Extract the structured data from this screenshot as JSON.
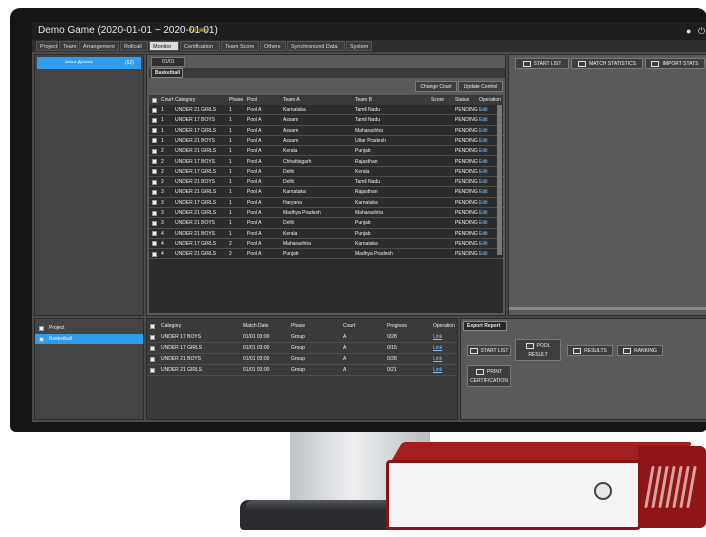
{
  "app": {
    "title": "Demo Game (2020-01-01 ~ 2020-01-01)",
    "mode": "Modify",
    "menu": [
      "Project",
      "Team",
      "Arrangement",
      "Rollcall",
      "Monitor",
      "Certification",
      "Team Score",
      "Others",
      "Synchronized Data",
      "System"
    ],
    "active_menu": "Monitor"
  },
  "left_top": {
    "selected": "==== A====",
    "count": "(52)"
  },
  "center": {
    "date_tab": "01/01",
    "sport_tab": "Basketball",
    "buttons": [
      "Change Court",
      "Update Control"
    ],
    "columns": [
      "Court",
      "Category",
      "Phase",
      "Pool",
      "Team A",
      "Team B",
      "Score",
      "Status",
      "Operation"
    ],
    "rows": [
      [
        "1",
        "UNDER 21 GIRLS",
        "1",
        "Pool A",
        "Karnataka",
        "Tamil Nadu",
        "",
        "PENDING",
        "Edit"
      ],
      [
        "1",
        "UNDER 17 BOYS",
        "1",
        "Pool A",
        "Assam",
        "Tamil Nadu",
        "",
        "PENDING",
        "Edit"
      ],
      [
        "1",
        "UNDER 17 GIRLS",
        "1",
        "Pool A",
        "Assam",
        "Maharashtra",
        "",
        "PENDING",
        "Edit"
      ],
      [
        "1",
        "UNDER 21 BOYS",
        "1",
        "Pool A",
        "Assam",
        "Uttar Pradesh",
        "",
        "PENDING",
        "Edit"
      ],
      [
        "2",
        "UNDER 21 GIRLS",
        "1",
        "Pool A",
        "Kerala",
        "Punjab",
        "",
        "PENDING",
        "Edit"
      ],
      [
        "2",
        "UNDER 17 BOYS",
        "1",
        "Pool A",
        "Chhattisgarh",
        "Rajasthan",
        "",
        "PENDING",
        "Edit"
      ],
      [
        "2",
        "UNDER 17 GIRLS",
        "1",
        "Pool A",
        "Delhi",
        "Kerala",
        "",
        "PENDING",
        "Edit"
      ],
      [
        "2",
        "UNDER 21 BOYS",
        "1",
        "Pool A",
        "Delhi",
        "Tamil Nadu",
        "",
        "PENDING",
        "Edit"
      ],
      [
        "3",
        "UNDER 21 GIRLS",
        "1",
        "Pool A",
        "Karnataka",
        "Rajasthan",
        "",
        "PENDING",
        "Edit"
      ],
      [
        "3",
        "UNDER 17 GIRLS",
        "1",
        "Pool A",
        "Haryana",
        "Karnataka",
        "",
        "PENDING",
        "Edit"
      ],
      [
        "3",
        "UNDER 21 GIRLS",
        "1",
        "Pool A",
        "Madhya Pradesh",
        "Maharashtra",
        "",
        "PENDING",
        "Edit"
      ],
      [
        "3",
        "UNDER 21 BOYS",
        "1",
        "Pool A",
        "Delhi",
        "Punjab",
        "",
        "PENDING",
        "Edit"
      ],
      [
        "4",
        "UNDER 21 BOYS",
        "1",
        "Pool A",
        "Kerala",
        "Punjab",
        "",
        "PENDING",
        "Edit"
      ],
      [
        "4",
        "UNDER 17 GIRLS",
        "2",
        "Pool A",
        "Maharashtra",
        "Karnataka",
        "",
        "PENDING",
        "Edit"
      ],
      [
        "4",
        "UNDER 21 GIRLS",
        "2",
        "Pool A",
        "Punjab",
        "Madhya Pradesh",
        "",
        "PENDING",
        "Edit"
      ]
    ]
  },
  "right_top": {
    "buttons": [
      "START LIST",
      "MATCH STATISTICS",
      "IMPORT STATS"
    ]
  },
  "left_bottom": {
    "items": [
      "Project",
      "Basketball"
    ]
  },
  "bottom_center": {
    "columns": [
      "Category",
      "Match Date",
      "Phase",
      "Court",
      "Progress",
      "Operation"
    ],
    "rows": [
      [
        "UNDER 17 BOYS",
        "01/01 03:00",
        "Group",
        "A",
        "0/28",
        "Link"
      ],
      [
        "UNDER 17 GIRLS",
        "01/01 03:00",
        "Group",
        "A",
        "0/15",
        "Link"
      ],
      [
        "UNDER 21 BOYS",
        "01/01 03:00",
        "Group",
        "A",
        "0/28",
        "Link"
      ],
      [
        "UNDER 21 GIRLS",
        "01/01 03:00",
        "Group",
        "A",
        "0/21",
        "Link"
      ]
    ]
  },
  "export": {
    "tab": "Export Report",
    "start_list": "START LIST",
    "pool_1": "POOL",
    "pool_2": "RESULT",
    "results": "RESULTS",
    "ranking": "RANKING",
    "print_1": "PRINT",
    "print_2": "CERTIFICATION"
  }
}
